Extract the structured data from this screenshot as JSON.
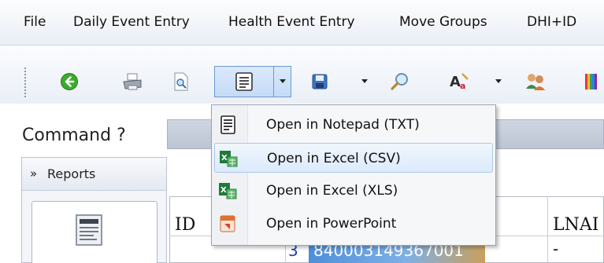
{
  "menubar": {
    "items": [
      "File",
      "Daily Event Entry",
      "Health Event Entry",
      "Move Groups",
      "DHI+ID"
    ]
  },
  "toolbar": {
    "buttons": [
      "back-icon",
      "print-icon",
      "print-preview-icon",
      "export-icon",
      "save-icon",
      "find-icon",
      "font-icon",
      "people-icon",
      "color-icon"
    ],
    "pressed": "export-icon"
  },
  "dropdown": {
    "items": [
      {
        "label": "Open in Notepad (TXT)",
        "icon": "notepad-icon"
      },
      {
        "label": "Open in Excel (CSV)",
        "icon": "excel-icon"
      },
      {
        "label": "Open in Excel (XLS)",
        "icon": "excel-icon"
      },
      {
        "label": "Open in PowerPoint",
        "icon": "powerpoint-icon"
      }
    ],
    "highlighted_index": 1
  },
  "left_panel": {
    "title": "Command ?",
    "section": {
      "chevron": "»",
      "label": "Reports"
    }
  },
  "grid": {
    "headers": [
      "ID",
      "LNAI"
    ],
    "rows": [
      {
        "num": "3",
        "id": "840003149367001",
        "lname": "-"
      }
    ]
  },
  "colors": {
    "accent": "#6d99cf",
    "highlight": "#dceafb",
    "link": "#1f3db5"
  }
}
